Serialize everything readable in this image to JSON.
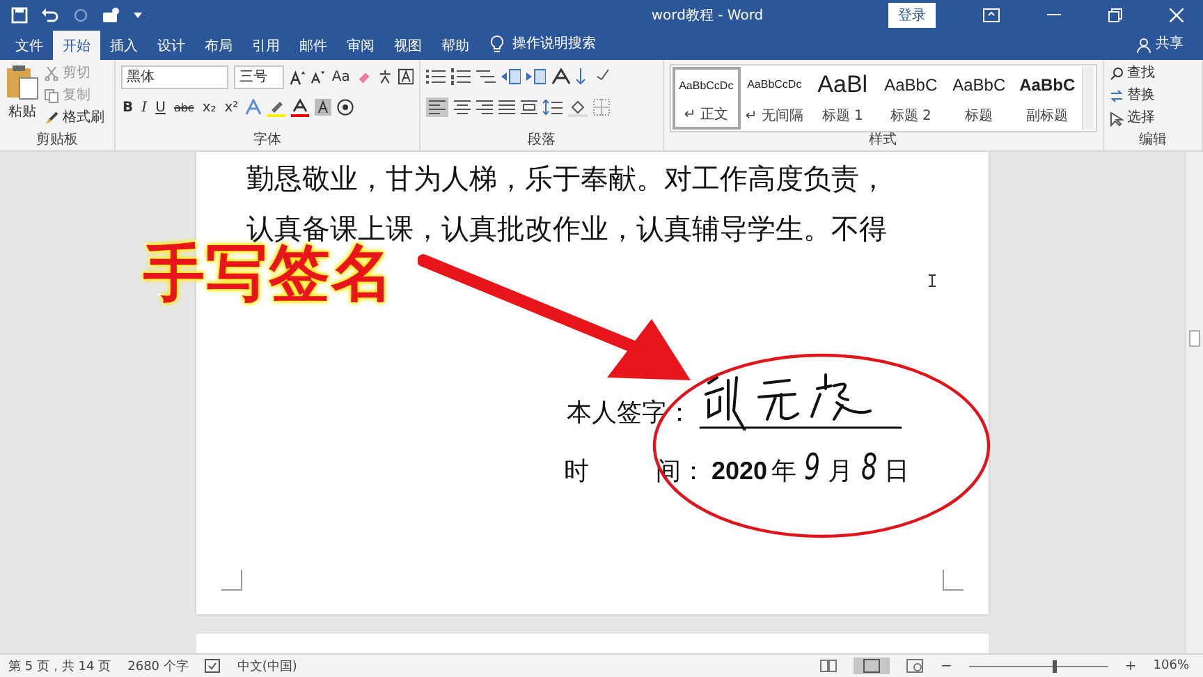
{
  "title_bar": {
    "title": "word教程  -  Word",
    "login": "登录"
  },
  "menu_tabs": [
    {
      "label": "文件",
      "selected": false
    },
    {
      "label": "开始",
      "selected": true
    },
    {
      "label": "插入",
      "selected": false
    },
    {
      "label": "设计",
      "selected": false
    },
    {
      "label": "布局",
      "selected": false
    },
    {
      "label": "引用",
      "selected": false
    },
    {
      "label": "邮件",
      "selected": false
    },
    {
      "label": "审阅",
      "selected": false
    },
    {
      "label": "视图",
      "selected": false
    },
    {
      "label": "帮助",
      "selected": false
    }
  ],
  "tell_me": "操作说明搜索",
  "share": "共享",
  "clipboard": {
    "paste": "粘贴",
    "cut": "剪切",
    "copy": "复制",
    "format_painter": "格式刷",
    "label": "剪贴板"
  },
  "font": {
    "name": "黑体",
    "size": "三号",
    "case_button": "Aa",
    "format_buttons": [
      "B",
      "I",
      "U",
      "abc",
      "x₂",
      "x²"
    ],
    "label": "字体"
  },
  "paragraph": {
    "label": "段落"
  },
  "styles": {
    "label": "样式",
    "items": [
      {
        "preview": "AaBbCcDc",
        "name": "↵ 正文",
        "kind": "body",
        "selected": true
      },
      {
        "preview": "AaBbCcDc",
        "name": "↵ 无间隔",
        "kind": "body",
        "selected": false
      },
      {
        "preview": "AaBl",
        "name": "标题 1",
        "kind": "heading",
        "selected": false
      },
      {
        "preview": "AaBbC",
        "name": "标题 2",
        "kind": "sub",
        "selected": false
      },
      {
        "preview": "AaBbC",
        "name": "标题",
        "kind": "sub",
        "selected": false
      },
      {
        "preview": "AaBbC",
        "name": "副标题",
        "kind": "strong",
        "selected": false
      }
    ]
  },
  "editing": {
    "find": "查找",
    "replace": "替换",
    "select": "选择",
    "label": "编辑"
  },
  "document": {
    "paragraphs": [
      "勤恳敬业，甘为人梯，乐于奉献。对工作高度负责，",
      "认真备课上课，认真批改作业，认真辅导学生。不得"
    ],
    "signature_label": "本人签字：",
    "time_label": [
      "时",
      "间："
    ],
    "date": [
      {
        "text": "2020",
        "kind": "bold"
      },
      {
        "text": "年",
        "kind": "printed"
      },
      {
        "text": "9",
        "kind": "handwritten"
      },
      {
        "text": "月",
        "kind": "printed"
      },
      {
        "text": "8",
        "kind": "handwritten"
      },
      {
        "text": "日",
        "kind": "printed"
      }
    ]
  },
  "overlay": {
    "title": "手写签名"
  },
  "status_bar": {
    "page": "第 5 页，共 14 页",
    "words": "2680 个字",
    "language": "中文(中国)",
    "zoom_out": "−",
    "zoom_slider": {
      "level": 0.62
    },
    "zoom_in": "+",
    "zoom": "106%"
  }
}
